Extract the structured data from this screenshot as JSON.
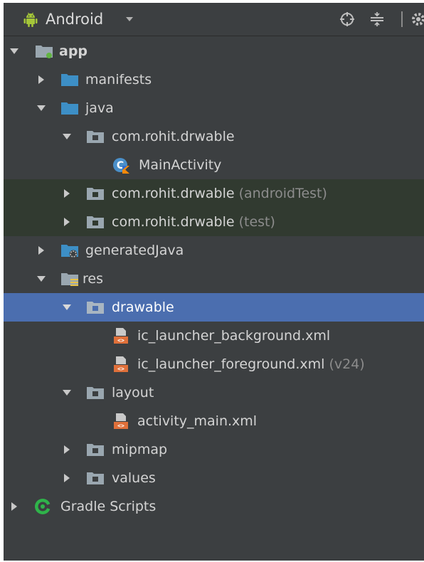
{
  "toolbar": {
    "view_label": "Android",
    "icons": [
      "android-icon",
      "dropdown-icon",
      "locate-icon",
      "collapse-icon",
      "gear-icon"
    ]
  },
  "tree": {
    "app": "app",
    "manifests": "manifests",
    "java": "java",
    "pkg_main": "com.rohit.drwable",
    "main_activity": "MainActivity",
    "pkg_android_test": "com.rohit.drwable",
    "pkg_android_test_suffix": "(androidTest)",
    "pkg_test": "com.rohit.drwable",
    "pkg_test_suffix": "(test)",
    "generated_java": "generatedJava",
    "res": "res",
    "drawable": "drawable",
    "ic_bg": "ic_launcher_background.xml",
    "ic_fg": "ic_launcher_foreground.xml",
    "ic_fg_suffix": "(v24)",
    "layout": "layout",
    "activity_main": "activity_main.xml",
    "mipmap": "mipmap",
    "values": "values",
    "gradle_scripts": "Gradle Scripts"
  },
  "colors": {
    "panel_bg": "#3c3f41",
    "selection": "#4b6eaf",
    "test_bg": "#313a30",
    "folder_blue": "#3d8fc6",
    "android_green": "#a4c639",
    "gradle_green": "#2fb34a",
    "xml_orange": "#e0703a"
  }
}
